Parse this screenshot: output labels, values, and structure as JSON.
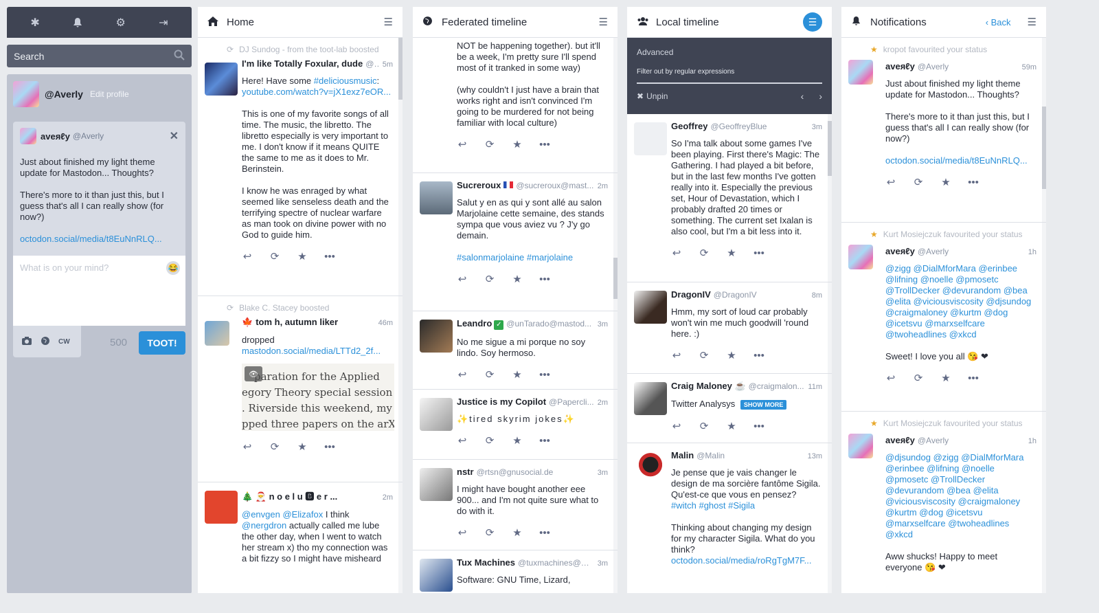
{
  "drawer": {
    "nav_icons": [
      "asterisk-icon",
      "bell-icon",
      "gear-icon",
      "sign-out-icon"
    ],
    "search_placeholder": "Search",
    "me": {
      "handle": "@Averly",
      "edit_label": "Edit profile"
    },
    "reply": {
      "name": "aveяℓy",
      "handle": "@Averly",
      "paragraphs": [
        "Just about finished my light theme update for Mastodon... Thoughts?",
        "There's more to it than just this, but I guess that's all I can really show (for now?)"
      ],
      "link": "octodon.social/media/t8EuNnRLQ..."
    },
    "compose_placeholder": "What is on your mind?",
    "cw_label": "CW",
    "char_count": "500",
    "toot_label": "TOOT!"
  },
  "home": {
    "title": "Home",
    "statuses": [
      {
        "boost": "DJ Sundog - from the toot-lab boosted",
        "name": "I'm like Totally Foxular, dude",
        "handle": "@...",
        "time": "5m",
        "p1_pre": "Here! Have some ",
        "p1_tag": "#deliciousmusic",
        "p1_post": ":",
        "p1_link": "youtube.com/watch?v=jX1exz7eOR...",
        "p2": "This is one of my favorite songs of all time. The music, the libretto. The libretto especially is very important to me. I don't know if it means QUITE the same to me as it does to Mr. Berinstein.",
        "p3": "I know he was enraged by what seemed like senseless death and the terrifying spectre of nuclear warfare as man took on divine power with no God to guide him."
      },
      {
        "boost": "Blake C. Stacey boosted",
        "name": "tom h, autumn liker",
        "time": "46m",
        "text": "dropped",
        "link": "mastodon.social/media/LTTd2_2f...",
        "media_lines": [
          "paration for the Applied",
          "egory Theory special session at",
          ". Riverside this weekend, my cre",
          "pped three papers on the arXiv."
        ]
      },
      {
        "name": "🎄 🎅 n o e l u 🅱 e r ...",
        "time": "2m",
        "mention1": "@envgen",
        "mention2": "@Elizafox",
        "t1": " I think ",
        "mention3": "@nergdron",
        "t2": " actually called me lube the other day, when I went to watch her stream x) tho my connection was a bit fizzy so I might have misheard"
      }
    ]
  },
  "federated": {
    "title": "Federated timeline",
    "statuses": [
      {
        "p1": "NOT be happening together). but it'll be a week, I'm pretty sure I'll spend most of it tranked in some way)",
        "p2": "(why couldn't I just have a brain that works right and isn't convinced I'm going to be murdered for not being familiar with local culture)"
      },
      {
        "name": "Sucreroux",
        "handle": "@sucreroux@mast...",
        "time": "2m",
        "text": "Salut y en as qui y sont allé au salon Marjolaine cette semaine, des stands sympa que vous aviez vu ? J'y go demain.",
        "tags": "#salonmarjolaine #marjolaine"
      },
      {
        "name": "Leandro",
        "handle": "@unTarado@mastod...",
        "time": "3m",
        "text": "No me sigue a mi porque no soy lindo. Soy hermoso."
      },
      {
        "name": "Justice is my Copilot",
        "handle": "@Papercli...",
        "time": "2m",
        "text": "✨tired skyrim jokes✨"
      },
      {
        "name": "nstr",
        "handle": "@rtsn@gnusocial.de",
        "time": "3m",
        "text": "I might have bought another eee 900... and I'm not quite sure what to do with it."
      },
      {
        "name": "Tux Machines",
        "handle": "@tuxmachines@m...",
        "time": "3m",
        "text": "Software: GNU Time, Lizard,"
      }
    ]
  },
  "local": {
    "title": "Local timeline",
    "advanced": {
      "title": "Advanced",
      "filter_label": "Filter out by regular expressions",
      "unpin_label": "Unpin"
    },
    "statuses": [
      {
        "name": "Geoffrey",
        "handle": "@GeoffreyBlue",
        "time": "3m",
        "text": "So I'ma talk about some games I've been playing. First there's Magic: The Gathering. I had played a bit before, but in the last few months I've gotten really into it. Especially the previous set, Hour of Devastation, which I probably drafted 20 times or something. The current set Ixalan is also cool, but I'm a bit less into it."
      },
      {
        "name": "DragonIV",
        "handle": "@DragonIV",
        "time": "8m",
        "text": "Hmm, my sort of loud car probably won't win me much goodwill 'round here. :)"
      },
      {
        "name": "Craig Maloney ☕",
        "handle": "@craigmalon...",
        "time": "11m",
        "text": "Twitter Analysys",
        "show_more": "SHOW MORE"
      },
      {
        "name": "Malin",
        "handle": "@Malin",
        "time": "13m",
        "p1": "Je pense que je vais changer le design de ma sorcière fantôme Sigila. Qu'est-ce que vous en pensez?",
        "tags": "#witch #ghost #Sigila",
        "p2": "Thinking about changing my design for my character Sigila. What do you think?",
        "link": "octodon.social/media/roRgTgM7F..."
      }
    ]
  },
  "notifications": {
    "title": "Notifications",
    "back_label": "Back",
    "items": [
      {
        "line": "kropot favourited your status",
        "name": "aveяℓy",
        "handle": "@Averly",
        "time": "59m",
        "p1": "Just about finished my light theme update for Mastodon... Thoughts?",
        "p2": "There's more to it than just this, but I guess that's all I can really show (for now?)",
        "link": "octodon.social/media/t8EuNnRLQ..."
      },
      {
        "line": "Kurt Mosiejczuk favourited your status",
        "name": "aveяℓy",
        "handle": "@Averly",
        "time": "1h",
        "mentions": "@zigg @DialMforMara @erinbee @lifning @noelle @pmosetc @TrollDecker @devurandom @bea @elita @viciousviscosity @djsundog @craigmaloney @kurtm @dog @icetsvu @marxselfcare @twoheadlines @xkcd",
        "text": "Sweet! I love you all 😘 ❤"
      },
      {
        "line": "Kurt Mosiejczuk favourited your status",
        "name": "aveяℓy",
        "handle": "@Averly",
        "time": "1h",
        "mentions": "@djsundog @zigg @DialMforMara @erinbee @lifning @noelle @pmosetc @TrollDecker @devurandom @bea @elita @viciousviscosity @craigmaloney @kurtm @dog @icetsvu @marxselfcare @twoheadlines @xkcd",
        "text": "Aww shucks! Happy to meet everyone 😘 ❤"
      }
    ]
  }
}
